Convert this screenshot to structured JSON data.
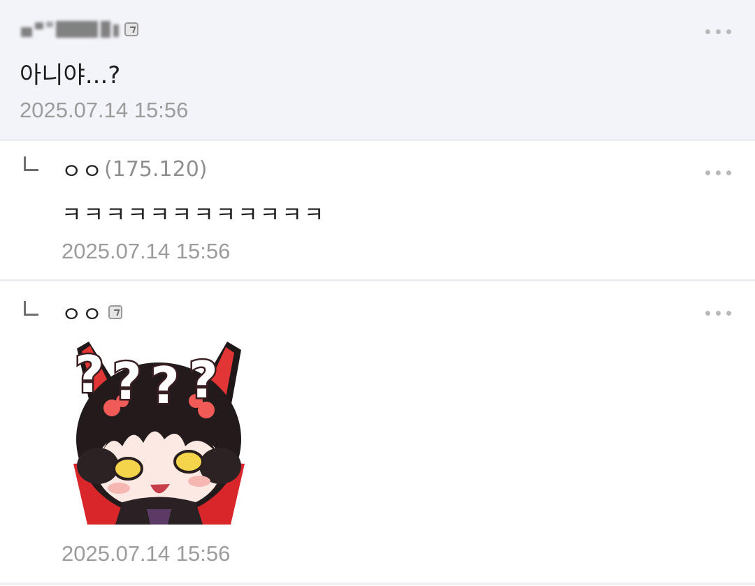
{
  "comments": [
    {
      "text": "아니야...?",
      "time": "2025.07.14 15:56"
    },
    {
      "nickname": "ㅇㅇ",
      "ip": "(175.120)",
      "text": "ㅋㅋㅋㅋㅋㅋㅋㅋㅋㅋㅋㅋ",
      "time": "2025.07.14 15:56"
    },
    {
      "nickname": "ㅇㅇ",
      "sticker": "dccon-fox-girl-question-marks",
      "time": "2025.07.14 15:56"
    }
  ],
  "colors": {
    "highlight_bg": "#f3f4fa",
    "text": "#1e1e1e",
    "muted": "#9c9c9c",
    "divider": "#ececf1"
  },
  "icons": {
    "more": "more-dots-icon",
    "reply": "reply-arrow-icon",
    "fixed_user": "fixed-user-badge-icon"
  }
}
